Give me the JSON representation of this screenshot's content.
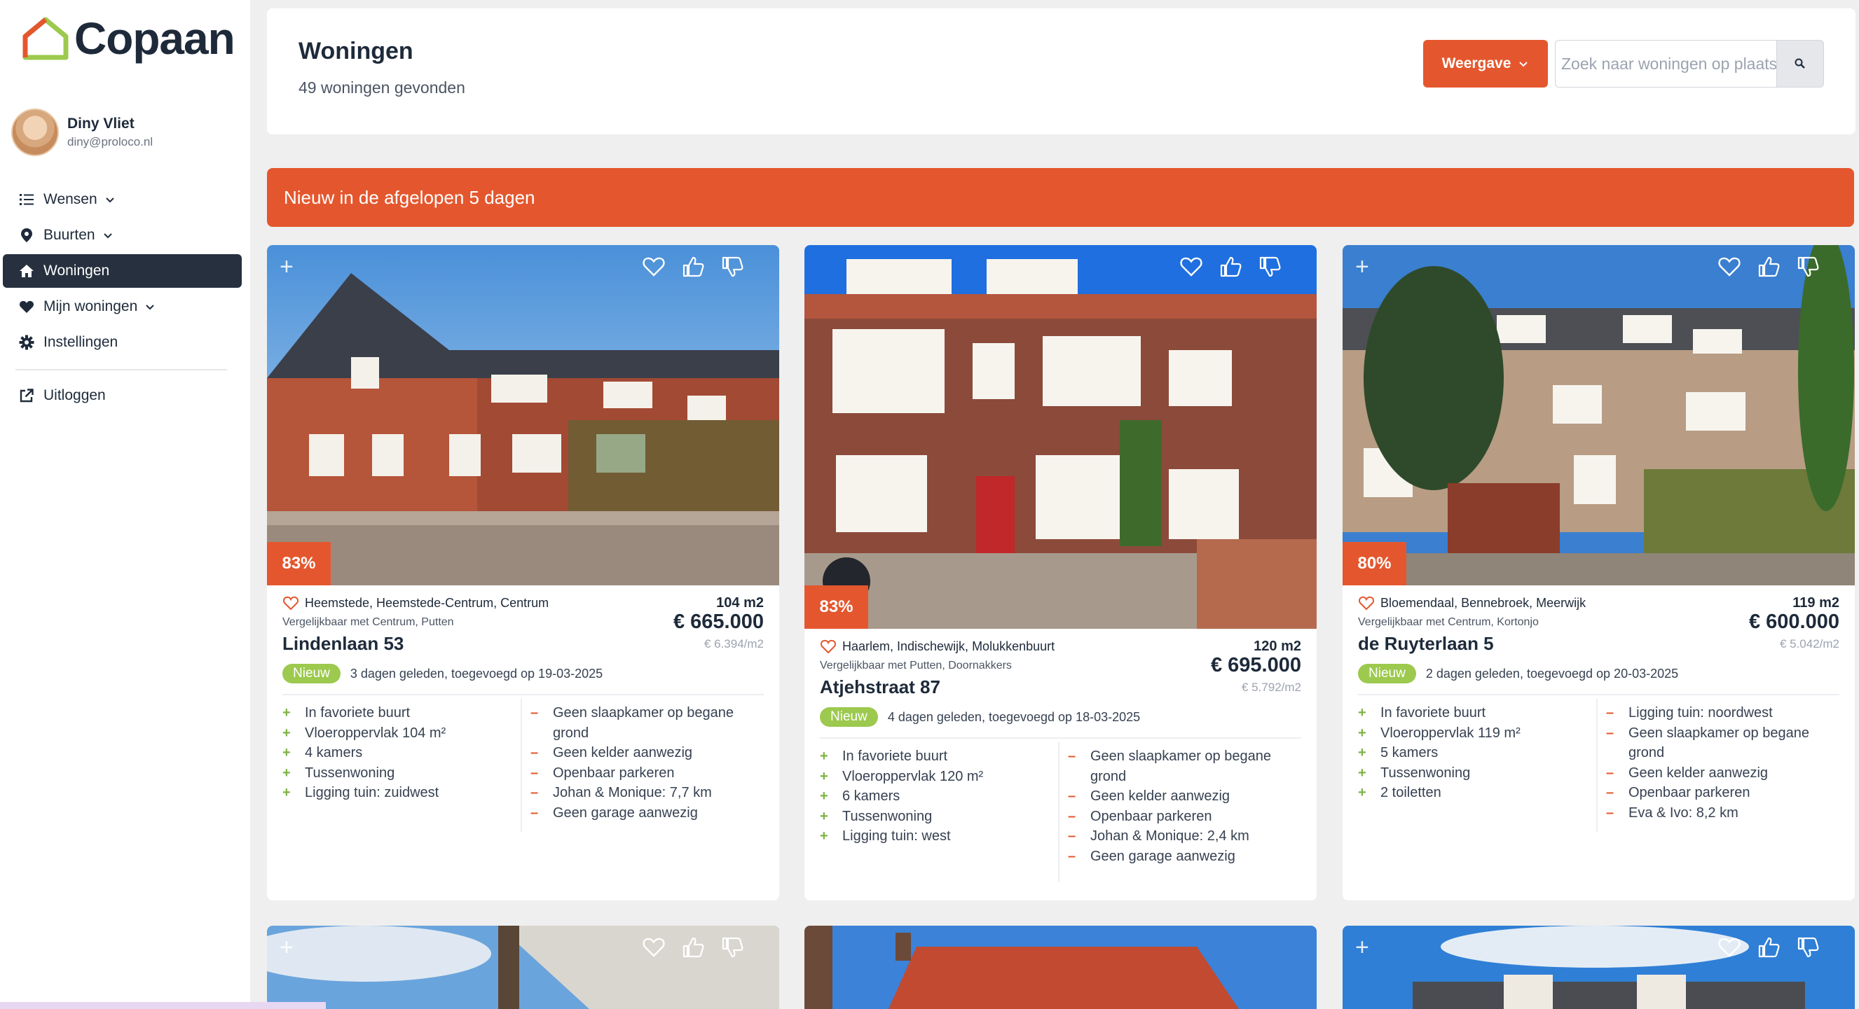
{
  "brand": {
    "name": "Copaan",
    "accent": "#e4572e",
    "dark": "#27303f"
  },
  "user": {
    "name": "Diny Vliet",
    "email": "diny@proloco.nl"
  },
  "nav": [
    {
      "label": "Wensen",
      "icon": "list-icon",
      "dropdown": true
    },
    {
      "label": "Buurten",
      "icon": "map-pin-icon",
      "dropdown": true
    },
    {
      "label": "Woningen",
      "icon": "home-icon",
      "active": true
    },
    {
      "label": "Mijn woningen",
      "icon": "heart-icon",
      "dropdown": true
    },
    {
      "label": "Instellingen",
      "icon": "gear-icon"
    },
    {
      "label": "Uitloggen",
      "icon": "external-link-icon"
    }
  ],
  "header": {
    "title": "Woningen",
    "subtitle": "49 woningen gevonden",
    "view_label": "Weergave",
    "search_placeholder": "Zoek naar woningen op plaats"
  },
  "banner": "Nieuw in de afgelopen 5 dagen",
  "listings": [
    {
      "match": "83%",
      "neighbourhoods": "Heemstede, Heemstede-Centrum, Centrum",
      "comparable": "Vergelijkbaar met Centrum, Putten",
      "street": "Lindenlaan 53",
      "area": "104 m2",
      "price": "€ 665.000",
      "price_per_m2": "€ 6.394/m2",
      "badge": "Nieuw",
      "added": "3 dagen geleden, toegevoegd op 19-03-2025",
      "pros": [
        "In favoriete buurt",
        "Vloeroppervlak 104 m²",
        "4 kamers",
        "Tussenwoning",
        "Ligging tuin: zuidwest"
      ],
      "cons": [
        "Geen slaapkamer op begane grond",
        "Geen kelder aanwezig",
        "Openbaar parkeren",
        "Johan & Monique: 7,7 km",
        "Geen garage aanwezig"
      ]
    },
    {
      "match": "83%",
      "neighbourhoods": "Haarlem, Indischewijk, Molukkenbuurt",
      "comparable": "Vergelijkbaar met Putten, Doornakkers",
      "street": "Atjehstraat 87",
      "area": "120 m2",
      "price": "€ 695.000",
      "price_per_m2": "€ 5.792/m2",
      "badge": "Nieuw",
      "added": "4 dagen geleden, toegevoegd op 18-03-2025",
      "pros": [
        "In favoriete buurt",
        "Vloeroppervlak 120 m²",
        "6 kamers",
        "Tussenwoning",
        "Ligging tuin: west"
      ],
      "cons": [
        "Geen slaapkamer op begane grond",
        "Geen kelder aanwezig",
        "Openbaar parkeren",
        "Johan & Monique: 2,4 km",
        "Geen garage aanwezig"
      ]
    },
    {
      "match": "80%",
      "neighbourhoods": "Bloemendaal, Bennebroek, Meerwijk",
      "comparable": "Vergelijkbaar met Centrum, Kortonjo",
      "street": "de Ruyterlaan 5",
      "area": "119 m2",
      "price": "€ 600.000",
      "price_per_m2": "€ 5.042/m2",
      "badge": "Nieuw",
      "added": "2 dagen geleden, toegevoegd op 20-03-2025",
      "pros": [
        "In favoriete buurt",
        "Vloeroppervlak 119 m²",
        "5 kamers",
        "Tussenwoning",
        "2 toiletten"
      ],
      "cons": [
        "Ligging tuin: noordwest",
        "Geen slaapkamer op begane grond",
        "Geen kelder aanwezig",
        "Openbaar parkeren",
        "Eva & Ivo: 8,2 km"
      ]
    }
  ]
}
